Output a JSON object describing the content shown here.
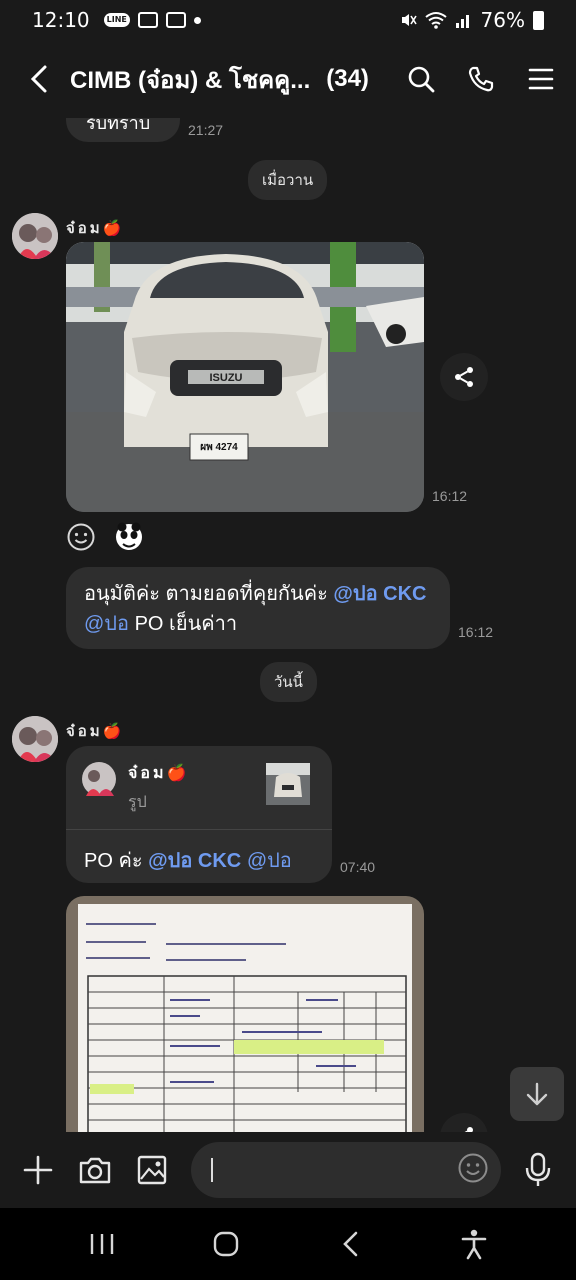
{
  "status_bar": {
    "time": "12:10",
    "line_badge": "LINE",
    "battery": "76%"
  },
  "header": {
    "title": "CIMB (จ๋อม) & โชคคู...",
    "count": "(34)"
  },
  "messages": {
    "prev_partial_text": "รับทราบ",
    "prev_partial_time": "21:27",
    "date_yesterday": "เมื่อวาน",
    "sender1_name": "จ๋อม",
    "sender1_emoji": "🍎",
    "photo1_plate": "ผพ 4274",
    "photo1_brand": "ISUZU",
    "photo1_time": "16:12",
    "approval_text_prefix": "อนุมัติค่ะ ตามยอดที่คุยกันค่ะ",
    "approval_mention1": "@ปอ CKC",
    "approval_mention2": "@ปอ",
    "approval_text_suffix": "PO เย็นค่าา",
    "approval_time": "16:12",
    "date_today": "วันนี้",
    "sender2_name": "จ๋อม",
    "sender2_emoji": "🍎",
    "reply_name": "จ๋อม",
    "reply_emoji": "🍎",
    "reply_type": "รูป",
    "po_text_prefix": "PO ค่ะ",
    "po_mention1": "@ปอ CKC",
    "po_mention2": "@ปอ",
    "po_time": "07:40"
  },
  "colors": {
    "background": "#1a1a1a",
    "bubble": "#2e2e2e",
    "mention": "#6f9bf0",
    "timestamp": "#9a9a9a"
  },
  "icons": {
    "back": "chevron-left-icon",
    "search": "search-icon",
    "call": "phone-icon",
    "menu": "hamburger-icon",
    "share": "share-icon",
    "add": "plus-icon",
    "camera": "camera-icon",
    "gallery": "image-icon",
    "emoji": "emoji-icon",
    "mic": "microphone-icon",
    "scroll_down": "arrow-down-icon"
  }
}
